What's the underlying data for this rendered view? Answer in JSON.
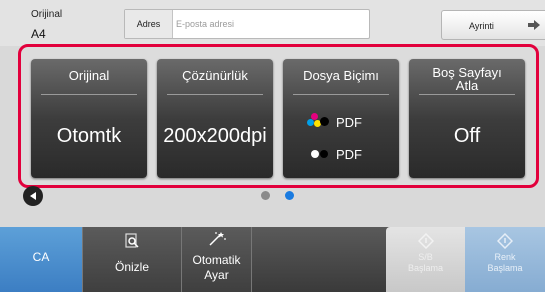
{
  "header": {
    "original_label": "Orijinal",
    "original_value": "A4",
    "address_label": "Adres",
    "address_placeholder": "E-posta adresi",
    "detail_button": "Ayrinti"
  },
  "tiles": [
    {
      "title": "Orijinal",
      "value": "Otomtk"
    },
    {
      "title": "Çözünürlük",
      "value": "200x200dpi"
    },
    {
      "title": "Dosya Biçimı",
      "color_format": "PDF",
      "bw_format": "PDF"
    },
    {
      "title_line1": "Boş Sayfayı",
      "title_line2": "Atla",
      "value": "Off"
    }
  ],
  "pager": {
    "pages": 2,
    "current_page": 2,
    "active_color": "#1a7be0",
    "inactive_color": "#8a8a8a"
  },
  "bottom": {
    "ca_label": "CA",
    "preview_label": "Önizle",
    "auto_label_line1": "Otomatik",
    "auto_label_line2": "Ayar",
    "bw_start_line1": "S/B",
    "bw_start_line2": "Başlama",
    "color_start_line1": "Renk",
    "color_start_line2": "Başlama"
  },
  "colors": {
    "accent_border": "#e2003c",
    "ca_button": "#4a8fd0",
    "disabled_start": "#d3d3d3",
    "color_start": "#8fb3d6"
  }
}
